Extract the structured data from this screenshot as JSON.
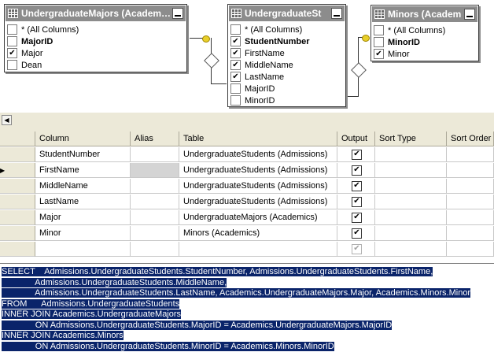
{
  "diagram": {
    "tables": [
      {
        "title": "UndergraduateMajors (Academics)",
        "columns": [
          {
            "label": "* (All Columns)",
            "checked": false,
            "bold": false
          },
          {
            "label": "MajorID",
            "checked": false,
            "bold": true
          },
          {
            "label": "Major",
            "checked": true,
            "bold": false
          },
          {
            "label": "Dean",
            "checked": false,
            "bold": false
          }
        ]
      },
      {
        "title": "UndergraduateSt",
        "columns": [
          {
            "label": "* (All Columns)",
            "checked": false,
            "bold": false
          },
          {
            "label": "StudentNumber",
            "checked": true,
            "bold": true
          },
          {
            "label": "FirstName",
            "checked": true,
            "bold": false
          },
          {
            "label": "MiddleName",
            "checked": true,
            "bold": false
          },
          {
            "label": "LastName",
            "checked": true,
            "bold": false
          },
          {
            "label": "MajorID",
            "checked": false,
            "bold": false
          },
          {
            "label": "MinorID",
            "checked": false,
            "bold": false
          }
        ]
      },
      {
        "title": "Minors (Academ",
        "columns": [
          {
            "label": "* (All Columns)",
            "checked": false,
            "bold": false
          },
          {
            "label": "MinorID",
            "checked": false,
            "bold": true
          },
          {
            "label": "Minor",
            "checked": true,
            "bold": false
          }
        ]
      }
    ]
  },
  "grid": {
    "headers": {
      "column": "Column",
      "alias": "Alias",
      "table": "Table",
      "output": "Output",
      "sort_type": "Sort Type",
      "sort_order": "Sort Order"
    },
    "rows": [
      {
        "column": "StudentNumber",
        "alias": "",
        "table": "UndergraduateStudents (Admissions)",
        "output": true
      },
      {
        "column": "FirstName",
        "alias": "",
        "table": "UndergraduateStudents (Admissions)",
        "output": true
      },
      {
        "column": "MiddleName",
        "alias": "",
        "table": "UndergraduateStudents (Admissions)",
        "output": true
      },
      {
        "column": "LastName",
        "alias": "",
        "table": "UndergraduateStudents (Admissions)",
        "output": true
      },
      {
        "column": "Major",
        "alias": "",
        "table": "UndergraduateMajors (Academics)",
        "output": true
      },
      {
        "column": "Minor",
        "alias": "",
        "table": "Minors (Academics)",
        "output": true
      },
      {
        "column": "",
        "alias": "",
        "table": "",
        "output": true
      }
    ],
    "current_row_marker": "▶"
  },
  "sql": {
    "lines": [
      "SELECT    Admissions.UndergraduateStudents.StudentNumber, Admissions.UndergraduateStudents.FirstName,",
      "              Admissions.UndergraduateStudents.MiddleName,",
      "              Admissions.UndergraduateStudents.LastName, Academics.UndergraduateMajors.Major, Academics.Minors.Minor",
      "FROM      Admissions.UndergraduateStudents",
      "INNER JOIN Academics.UndergraduateMajors",
      "              ON Admissions.UndergraduateStudents.MajorID = Academics.UndergraduateMajors.MajorID",
      "INNER JOIN Academics.Minors",
      "              ON Admissions.UndergraduateStudents.MinorID = Academics.Minors.MinorID"
    ]
  },
  "icons": {
    "table": "table-icon",
    "minimize": "minimize-icon",
    "key": "key-icon",
    "scroll_left": "◀"
  },
  "colors": {
    "selection": "#0a246a",
    "title_bar": "#8c8c8c",
    "chrome": "#ece9d8"
  }
}
